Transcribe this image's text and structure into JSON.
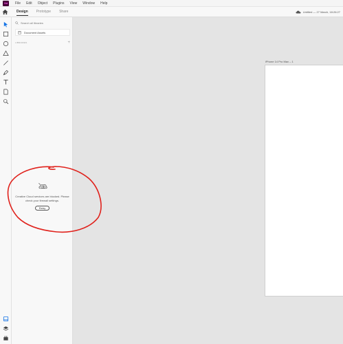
{
  "app": {
    "logo_text": "Xd",
    "menu": [
      "File",
      "Edit",
      "Object",
      "Plugins",
      "View",
      "Window",
      "Help"
    ]
  },
  "topbar": {
    "tabs": [
      {
        "label": "Design",
        "active": true
      },
      {
        "label": "Prototype",
        "active": false
      },
      {
        "label": "Share",
        "active": false
      }
    ],
    "document_title": "Untitled — 27 March, 18:26:27"
  },
  "toolbar": {
    "tools": [
      "select-icon",
      "rectangle-icon",
      "ellipse-icon",
      "polygon-icon",
      "line-icon",
      "pen-icon",
      "text-icon",
      "artboard-icon",
      "zoom-icon"
    ],
    "bottom_tools": [
      "assets-icon",
      "layers-icon",
      "plugins-icon"
    ],
    "accent_color": "#1473e6"
  },
  "panel": {
    "search_placeholder": "Search all libraries",
    "document_assets_label": "Document Assets",
    "libraries_label": "LIBRARIES",
    "add_label": "+",
    "error_message": "Creative Cloud services are blocked. Please check your firewall settings.",
    "retry_label": "Retry"
  },
  "canvas": {
    "artboard_name": "iPhone 14 Pro Max – 1"
  },
  "annotation": {
    "color": "#e0211b",
    "shape": "hand-drawn circle around error message"
  }
}
